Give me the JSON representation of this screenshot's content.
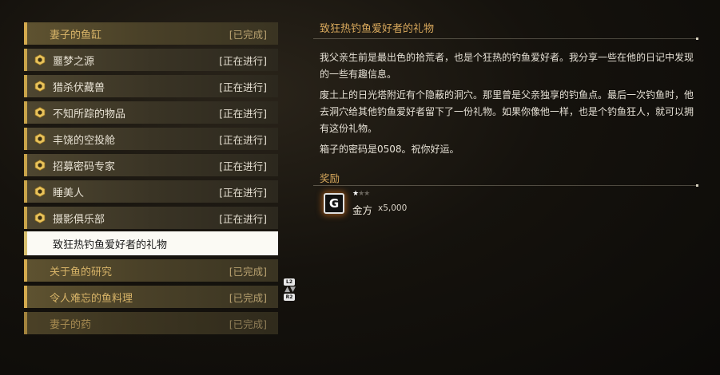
{
  "quest_list": {
    "items": [
      {
        "name": "妻子的鱼缸",
        "status": "[已完成]",
        "state": "completed"
      },
      {
        "name": "噩梦之源",
        "status": "[正在进行]",
        "state": "active"
      },
      {
        "name": "猎杀伏藏兽",
        "status": "[正在进行]",
        "state": "active"
      },
      {
        "name": "不知所踪的物品",
        "status": "[正在进行]",
        "state": "active"
      },
      {
        "name": "丰饶的空投舱",
        "status": "[正在进行]",
        "state": "active"
      },
      {
        "name": "招募密码专家",
        "status": "[正在进行]",
        "state": "active"
      },
      {
        "name": "睡美人",
        "status": "[正在进行]",
        "state": "active"
      },
      {
        "name": "摄影俱乐部",
        "status": "[正在进行]",
        "state": "active"
      },
      {
        "name": "致狂热钓鱼爱好者的礼物",
        "status": "",
        "state": "selected"
      },
      {
        "name": "关于鱼的研究",
        "status": "[已完成]",
        "state": "completed"
      },
      {
        "name": "令人难忘的鱼料理",
        "status": "[已完成]",
        "state": "completed"
      },
      {
        "name": "妻子的药",
        "status": "[已完成]",
        "state": "completed"
      }
    ]
  },
  "scroll_hint": {
    "up_button": "L2",
    "down_button": "R2",
    "arrows": "▲▼"
  },
  "detail": {
    "title": "致狂热钓鱼爱好者的礼物",
    "paragraphs": [
      "我父亲生前是最出色的拾荒者，也是个狂热的钓鱼爱好者。我分享一些在他的日记中发现的一些有趣信息。",
      "废土上的日光塔附近有个隐蔽的洞穴。那里曾是父亲独享的钓鱼点。最后一次钓鱼时，他去洞穴给其他钓鱼爱好者留下了一份礼物。如果你像他一样，也是个钓鱼狂人，就可以拥有这份礼物。",
      "箱子的密码是0508。祝你好运。"
    ],
    "reward_heading": "奖励",
    "reward": {
      "icon_letter": "G",
      "icon": "gold-coin-icon",
      "stars_filled": 1,
      "stars_total": 3,
      "name": "金方",
      "quantity": "x5,000"
    }
  }
}
